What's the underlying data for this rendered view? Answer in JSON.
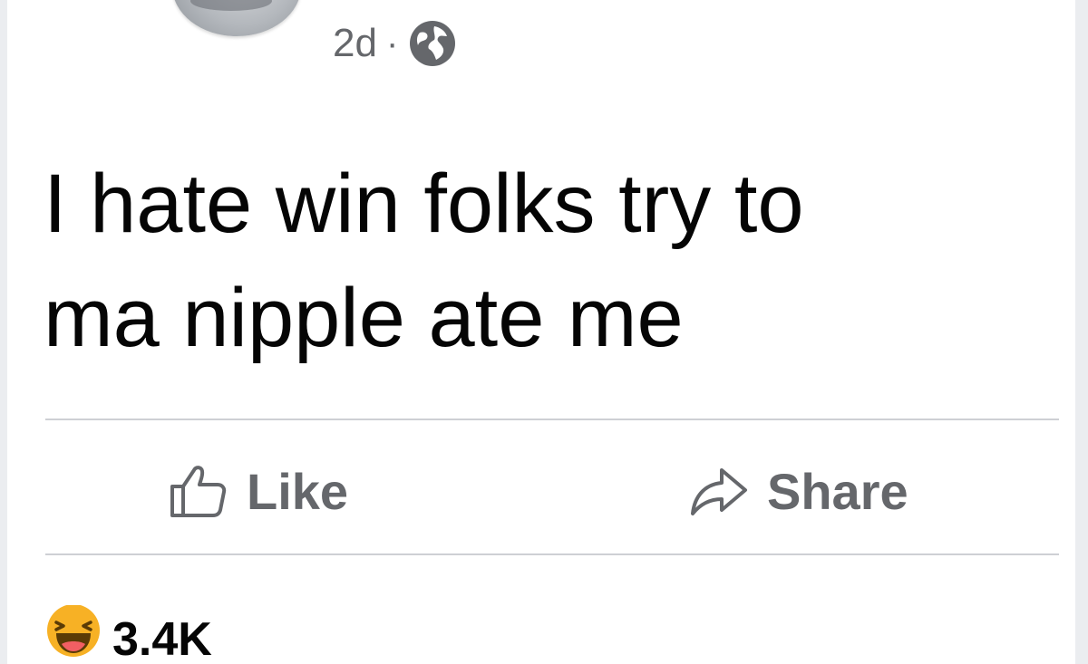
{
  "post": {
    "timestamp": "2d",
    "separator": "·",
    "privacy_icon": "globe-icon",
    "text_lines": [
      "I hate win folks try to",
      "ma nipple ate me"
    ]
  },
  "actions": {
    "like_label": "Like",
    "like_icon": "thumbs-up-icon",
    "share_label": "Share",
    "share_icon": "share-arrow-icon"
  },
  "reactions": {
    "icon": "laughing-emoji-icon",
    "count": "3.4K"
  },
  "colors": {
    "secondary_text": "#65676b",
    "primary_text": "#050505",
    "divider": "#ced0d4",
    "reaction_yellow": "#f7b125"
  }
}
